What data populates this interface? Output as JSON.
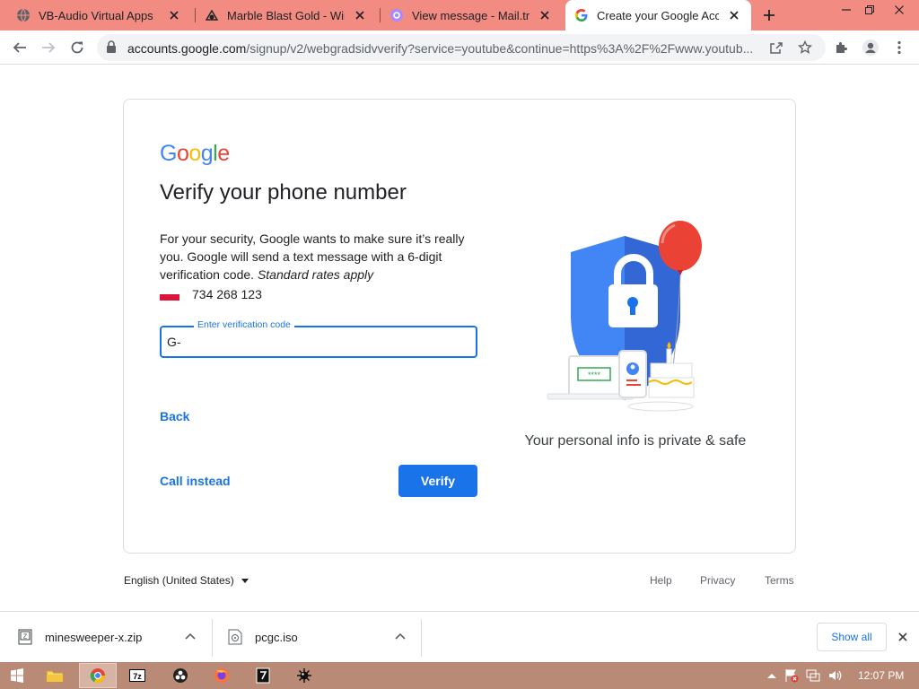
{
  "browser": {
    "tabs": [
      {
        "title": "VB-Audio Virtual Apps",
        "icon": "globe-icon",
        "active": false
      },
      {
        "title": "Marble Blast Gold - Windo",
        "icon": "marble-icon",
        "active": false
      },
      {
        "title": "View message - Mail.tm",
        "icon": "mail-icon",
        "active": false
      },
      {
        "title": "Create your Google Accou",
        "icon": "google-icon",
        "active": true
      }
    ],
    "url_host": "accounts.google.com",
    "url_path": "/signup/v2/webgradsidvverify?service=youtube&continue=https%3A%2F%2Fwww.youtub..."
  },
  "page": {
    "logo": "Google",
    "title": "Verify your phone number",
    "description": "For your security, Google wants to make sure it’s really you. Google will send a text message with a 6-digit verification code.",
    "rates_note": "Standard rates apply",
    "phone_number": "734 268 123",
    "field_label": "Enter verification code",
    "field_value": "G-",
    "back_label": "Back",
    "call_label": "Call instead",
    "verify_label": "Verify",
    "caption": "Your personal info is private & safe",
    "illustration_code": "****"
  },
  "footer": {
    "language": "English (United States)",
    "help": "Help",
    "privacy": "Privacy",
    "terms": "Terms"
  },
  "downloads": {
    "items": [
      {
        "name": "minesweeper-x.zip",
        "icon": "zip-file-icon"
      },
      {
        "name": "pcgc.iso",
        "icon": "disc-file-icon"
      }
    ],
    "show_all": "Show all"
  },
  "taskbar": {
    "clock": "12:07 PM"
  },
  "colors": {
    "accent": "#1a73e8",
    "tabstrip": "#f28b82",
    "taskbar": "#b98b76"
  }
}
